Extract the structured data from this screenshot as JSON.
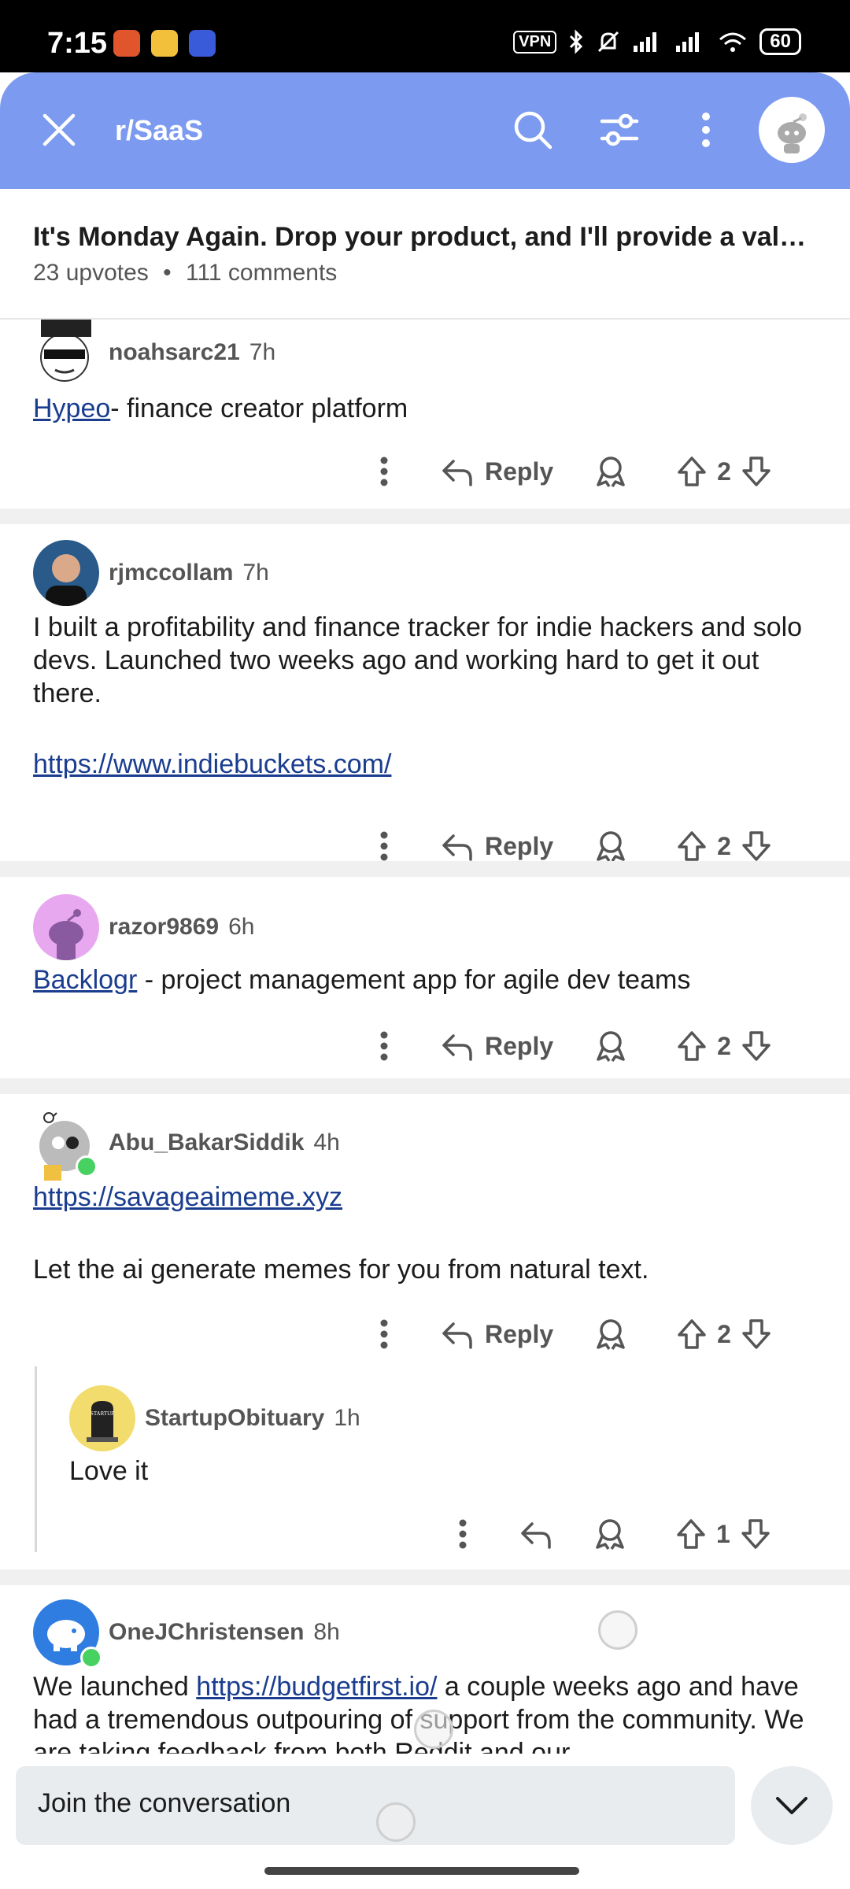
{
  "status_bar": {
    "time": "7:15",
    "vpn": "VPN",
    "battery": "60"
  },
  "header": {
    "subreddit": "r/SaaS"
  },
  "post": {
    "title": "It's Monday Again. Drop your product, and I'll provide a valua...",
    "upvotes": "23 upvotes",
    "dot": "•",
    "comments": "111 comments"
  },
  "comments": [
    {
      "user": "noahsarc21",
      "time": "7h",
      "link": "Hypeo",
      "text": "- finance creator platform",
      "reply": "Reply",
      "votes": "2"
    },
    {
      "user": "rjmccollam",
      "time": "7h",
      "text": "I built a profitability and finance tracker for indie hackers and solo devs. Launched two weeks ago and working hard to get it out there.",
      "link": "https://www.indiebuckets.com/",
      "reply": "Reply",
      "votes": "2"
    },
    {
      "user": "razor9869",
      "time": "6h",
      "link": "Backlogr",
      "text": " - project management app for agile dev teams",
      "reply": "Reply",
      "votes": "2"
    },
    {
      "user": "Abu_BakarSiddik",
      "time": "4h",
      "link": "https://savageaimeme.xyz",
      "text": "Let the ai generate memes for you from natural text.",
      "reply": "Reply",
      "votes": "2"
    },
    {
      "user": "StartupObituary",
      "time": "1h",
      "text": "Love it",
      "votes": "1"
    },
    {
      "user": "OneJChristensen",
      "time": "8h",
      "text_before": "We launched ",
      "link": "https://budgetfirst.io/",
      "text_after": " a couple weeks ago and have had a tremendous outpouring of support from the community. We are taking feedback from both Reddit and our"
    }
  ],
  "composer": {
    "placeholder": "Join the conversation"
  },
  "colors": {
    "header": "#7b9af0",
    "link": "#1a3d8f",
    "online": "#46d160"
  },
  "icons": [
    "close-icon",
    "search-icon",
    "filter-icon",
    "more-icon",
    "avatar",
    "reply-icon",
    "award-icon",
    "upvote-icon",
    "downvote-icon",
    "chevron-down-icon"
  ]
}
